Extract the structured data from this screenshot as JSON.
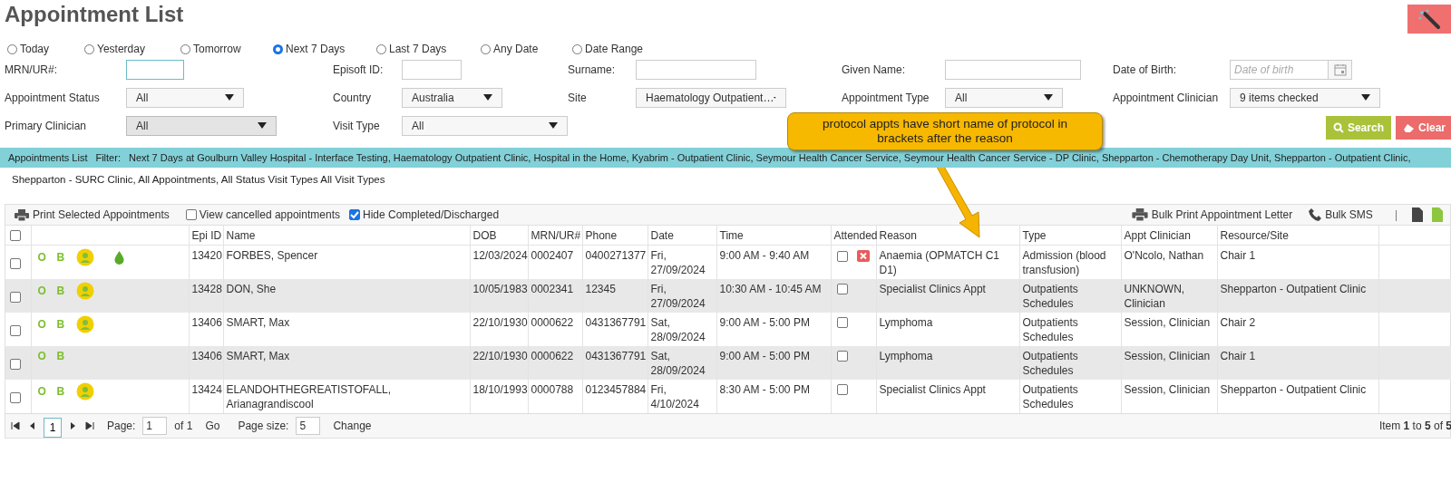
{
  "title": "Appointment List",
  "date_ranges": [
    {
      "label": "Today",
      "selected": false
    },
    {
      "label": "Yesterday",
      "selected": false
    },
    {
      "label": "Tomorrow",
      "selected": false
    },
    {
      "label": "Next 7 Days",
      "selected": true
    },
    {
      "label": "Last 7 Days",
      "selected": false
    },
    {
      "label": "Any Date",
      "selected": false
    },
    {
      "label": "Date Range",
      "selected": false
    }
  ],
  "filters": [
    {
      "label": "MRN/UR#:",
      "kind": "input",
      "focused": true
    },
    {
      "label": "Episoft ID:",
      "kind": "input",
      "focused": false
    },
    {
      "label": "Surname:",
      "kind": "input",
      "focused": false
    },
    {
      "label": "Given Name:",
      "kind": "input",
      "focused": false
    },
    {
      "label": "Date of Birth:",
      "kind": "date",
      "placeholder": "Date of birth"
    },
    {
      "label": "Appointment Status",
      "kind": "select",
      "value": "All",
      "disabled": false
    },
    {
      "label": "Country",
      "kind": "select",
      "value": "Australia",
      "disabled": false
    },
    {
      "label": "Site",
      "kind": "select",
      "value": "Haematology Outpatient…",
      "disabled": false
    },
    {
      "label": "Appointment Type",
      "kind": "select",
      "value": "All",
      "disabled": false
    },
    {
      "label": "Appointment Clinician",
      "kind": "select",
      "value": "9 items checked",
      "disabled": false
    },
    {
      "label": "Primary Clinician",
      "kind": "select",
      "value": "All",
      "disabled": true
    },
    {
      "label": "Visit Type",
      "kind": "select",
      "value": "All",
      "disabled": false
    }
  ],
  "buttons": {
    "search": "Search",
    "clear": "Clear"
  },
  "callout": "protocol appts have short name of protocol in brackets after the reason",
  "filter_bar": {
    "title": "Appointments List",
    "label": "Filter:",
    "text": "Next 7 Days at Goulburn Valley Hospital - Interface Testing, Haematology Outpatient Clinic, Hospital in the Home, Kyabrim - Outpatient Clinic, Seymour Health Cancer Service, Seymour Health Cancer Service - DP Clinic, Shepparton - Chemotherapy Day Unit, Shepparton - Outpatient Clinic,",
    "continuation": "Shepparton - SURC Clinic, All Appointments, All Status Visit Types All Visit Types"
  },
  "toolbar": {
    "print": "Print Selected Appointments",
    "options": [
      {
        "label": "View cancelled appointments",
        "checked": false
      },
      {
        "label": "Hide Completed/Discharged",
        "checked": true
      }
    ],
    "bulk_print": "Bulk Print Appointment Letter",
    "bulk_sms": "Bulk SMS",
    "separator": "|"
  },
  "table": {
    "columns": [
      "Epi ID",
      "Name",
      "DOB",
      "MRN/UR#",
      "Phone",
      "Date",
      "Time",
      "Attended",
      "Reason",
      "Type",
      "Appt Clinician",
      "Resource/Site"
    ],
    "all_selected": false,
    "rows": [
      {
        "selected": false,
        "badges": [
          "O",
          "B"
        ],
        "patient_icon": true,
        "drop_icon": true,
        "epi_id": "13420",
        "name": "FORBES, Spencer",
        "dob": "12/03/2024",
        "mrn": "0002407",
        "phone": "0400271377",
        "date": "Fri, 27/09/2024",
        "time": "9:00 AM - 9:40 AM",
        "attended": false,
        "cancel_icon": true,
        "reason": "Anaemia (OPMATCH C1 D1)",
        "type": "Admission (blood transfusion)",
        "clinician": "O'Ncolo, Nathan",
        "resource": "Chair 1"
      },
      {
        "selected": false,
        "badges": [
          "O",
          "B"
        ],
        "patient_icon": true,
        "drop_icon": false,
        "epi_id": "13428",
        "name": "DON, She",
        "dob": "10/05/1983",
        "mrn": "0002341",
        "phone": "12345",
        "date": "Fri, 27/09/2024",
        "time": "10:30 AM - 10:45 AM",
        "attended": false,
        "cancel_icon": false,
        "reason": "Specialist Clinics Appt",
        "type": "Outpatients Schedules",
        "clinician": "UNKNOWN, Clinician",
        "resource": "Shepparton - Outpatient Clinic"
      },
      {
        "selected": false,
        "badges": [
          "O",
          "B"
        ],
        "patient_icon": true,
        "drop_icon": false,
        "epi_id": "13406",
        "name": "SMART, Max",
        "dob": "22/10/1930",
        "mrn": "0000622",
        "phone": "0431367791",
        "date": "Sat, 28/09/2024",
        "time": "9:00 AM - 5:00 PM",
        "attended": false,
        "cancel_icon": false,
        "reason": "Lymphoma",
        "type": "Outpatients Schedules",
        "clinician": "Session, Clinician",
        "resource": "Chair 2"
      },
      {
        "selected": false,
        "badges": [
          "O",
          "B"
        ],
        "patient_icon": false,
        "drop_icon": false,
        "epi_id": "13406",
        "name": "SMART, Max",
        "dob": "22/10/1930",
        "mrn": "0000622",
        "phone": "0431367791",
        "date": "Sat, 28/09/2024",
        "time": "9:00 AM - 5:00 PM",
        "attended": false,
        "cancel_icon": false,
        "reason": "Lymphoma",
        "type": "Outpatients Schedules",
        "clinician": "Session, Clinician",
        "resource": "Chair 1"
      },
      {
        "selected": false,
        "badges": [
          "O",
          "B"
        ],
        "patient_icon": true,
        "drop_icon": false,
        "epi_id": "13424",
        "name": "ELANDOHTHEGREATISTOFALL, Arianagrandiscool",
        "dob": "18/10/1993",
        "mrn": "0000788",
        "phone": "0123457884",
        "date": "Fri, 4/10/2024",
        "time": "8:30 AM - 5:00 PM",
        "attended": false,
        "cancel_icon": false,
        "reason": "Specialist Clinics Appt",
        "type": "Outpatients Schedules",
        "clinician": "Session, Clinician",
        "resource": "Shepparton - Outpatient Clinic"
      }
    ]
  },
  "pager": {
    "pages": [
      {
        "label": "1",
        "selected": true
      }
    ],
    "page_label": "Page:",
    "page_value": "1",
    "of": "of 1",
    "go": "Go",
    "size_label": "Page size:",
    "size_value": "5",
    "change": "Change",
    "summary": "Item **1** to **5** of **5**"
  }
}
